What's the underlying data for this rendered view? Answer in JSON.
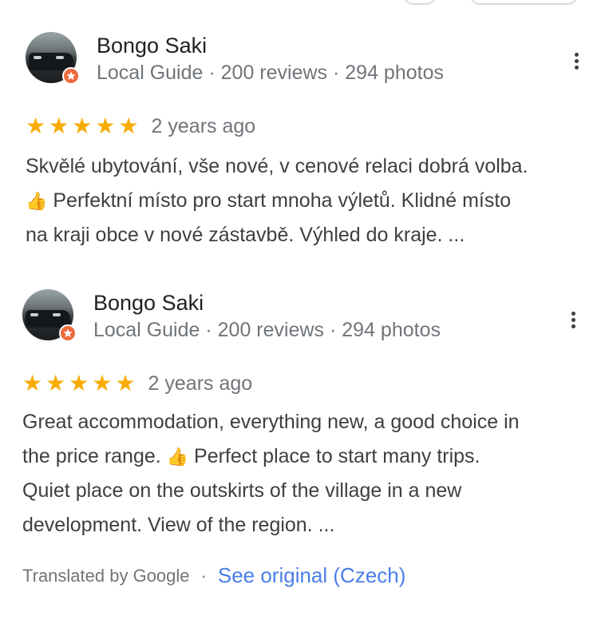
{
  "reviews": [
    {
      "author": "Bongo Saki",
      "meta": "Local Guide · 200 reviews · 294 photos",
      "rating": 5,
      "stars": [
        "★",
        "★",
        "★",
        "★",
        "★"
      ],
      "time": "2 years ago",
      "lines": [
        {
          "text": "Skvělé ubytování, vše nové, v cenové relaci dobrá volba."
        },
        {
          "pre": "",
          "post": "Perfektní místo pro start mnoha výletů. Klidné místo"
        },
        {
          "text": "na kraji obce v nové zástavbě. Výhled do kraje. ..."
        }
      ]
    },
    {
      "author": "Bongo Saki",
      "meta": "Local Guide · 200 reviews · 294 photos",
      "rating": 5,
      "stars": [
        "★",
        "★",
        "★",
        "★",
        "★"
      ],
      "time": "2 years ago",
      "lines": [
        {
          "text": "Great accommodation, everything new, a good choice in"
        },
        {
          "pre": "the price range.",
          "post": "Perfect place to start many trips."
        },
        {
          "text": "Quiet place on the outskirts of the village in a new"
        },
        {
          "text": "development. View of the region. ..."
        }
      ]
    }
  ],
  "translation": {
    "label": "Translated by Google",
    "separator": "·",
    "link": "See original (Czech)"
  },
  "icons": {
    "thumb": "👍",
    "star": "★"
  },
  "colors": {
    "star": "#f9ab00",
    "badge": "#ee6a3c",
    "link": "#4a7ee8",
    "secondary_text": "#70757a"
  }
}
